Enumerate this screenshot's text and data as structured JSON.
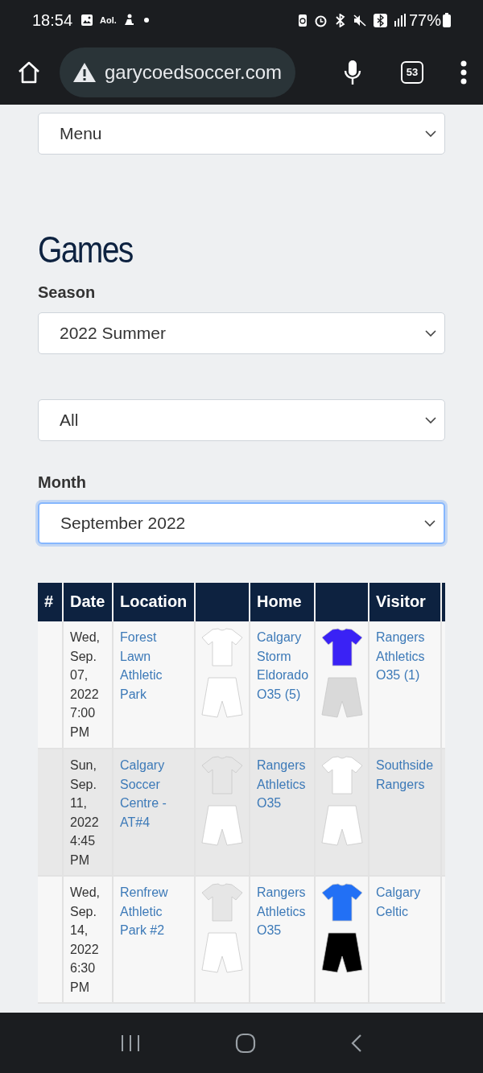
{
  "status_bar": {
    "time": "18:54",
    "notification_text": "Aol.",
    "battery": "77%"
  },
  "browser": {
    "url": "garycoedsoccer.com",
    "tab_count": "53"
  },
  "menu_select": {
    "value": "Menu"
  },
  "heading": "Games",
  "filters": [
    {
      "label": "Season",
      "value": "2022 Summer",
      "focused": false
    },
    {
      "value": "All",
      "focused": false
    },
    {
      "label": "Month",
      "value": "September 2022",
      "focused": true
    }
  ],
  "table": {
    "columns": [
      {
        "kind": "text",
        "label": "#"
      },
      {
        "kind": "text",
        "label": "Date"
      },
      {
        "kind": "text",
        "label": "Location"
      },
      {
        "kind": "blank"
      },
      {
        "kind": "text",
        "label": "Home"
      },
      {
        "kind": "blank"
      },
      {
        "kind": "text",
        "label": "Visitor"
      },
      {
        "kind": "blank"
      }
    ],
    "rows": [
      {
        "date": "Wed, Sep. 07, 2022 7:00 PM",
        "location": "Forest Lawn Athletic Park",
        "home_kit": {
          "shirt": {
            "color": "#ffffff"
          },
          "shorts": {
            "color": "#ffffff"
          }
        },
        "home": "Calgary Storm Eldorado O35 (5)",
        "visitor_kit": {
          "shirt": {
            "color": "#3a22f5"
          },
          "shorts": {
            "color": "#d9d9d9"
          }
        },
        "visitor": "Rangers Athletics O35 (1)"
      },
      {
        "date": "Sun, Sep. 11, 2022 4:45 PM",
        "location": "Calgary Soccer Centre - AT#4",
        "home_kit": {
          "shirt": {
            "color": "#e6e6e6"
          },
          "shorts": {
            "color": "#ffffff"
          }
        },
        "home": "Rangers Athletics O35",
        "visitor_kit": {
          "shirt": {
            "color": "#ffffff"
          },
          "shorts": {
            "color": "#ffffff"
          }
        },
        "visitor": "Southside Rangers"
      },
      {
        "date": "Wed, Sep. 14, 2022 6:30 PM",
        "location": "Renfrew Athletic Park #2",
        "home_kit": {
          "shirt": {
            "color": "#e6e6e6"
          },
          "shorts": {
            "color": "#ffffff"
          }
        },
        "home": "Rangers Athletics O35",
        "visitor_kit": {
          "shirt": {
            "color": "#2270f5"
          },
          "shorts": {
            "color": "#000000"
          }
        },
        "visitor": "Calgary Celtic"
      }
    ]
  }
}
